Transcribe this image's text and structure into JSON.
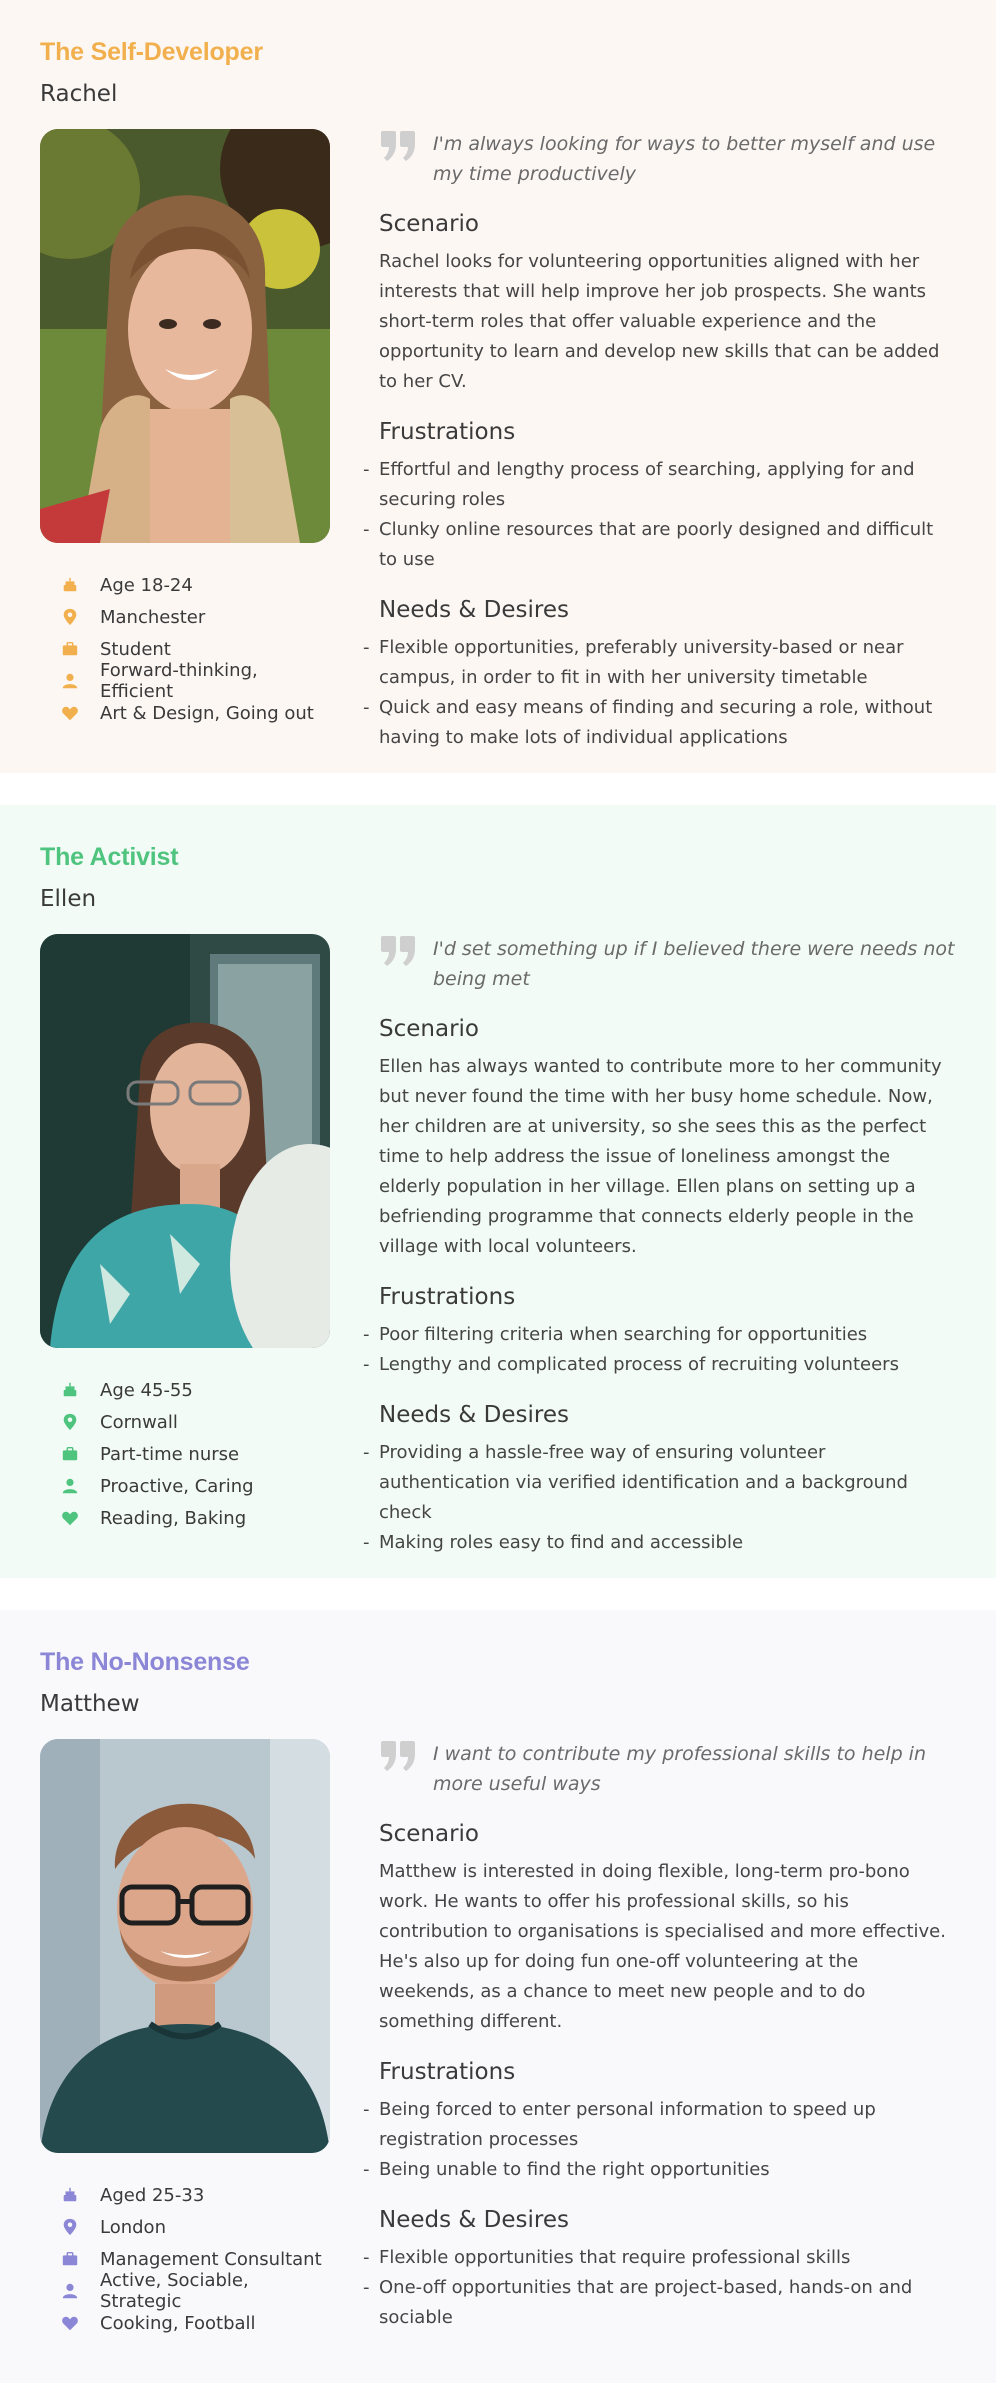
{
  "personas": [
    {
      "type": "The Self-Developer",
      "name": "Rachel",
      "accent": "#f1b04d",
      "quote": "I'm always looking for ways to better myself and use my time productively",
      "scenario_heading": "Scenario",
      "scenario": "Rachel looks for volunteering opportunities aligned with her interests that will help improve her job prospects. She wants short-term roles that offer valuable experience and the opportunity to learn and develop new skills that can be added to her CV.",
      "frustrations_heading": "Frustrations",
      "frustrations": [
        "Effortful and lengthy process of searching, applying for and securing roles",
        "Clunky online resources that are poorly designed and difficult to use"
      ],
      "needs_heading": "Needs & Desires",
      "needs": [
        "Flexible opportunities, preferably university-based or near campus, in order to fit in with her university timetable",
        "Quick and easy means of finding and securing a role, without having to make lots of individual applications"
      ],
      "facts": [
        {
          "icon": "cake-icon",
          "text": "Age 18-24"
        },
        {
          "icon": "location-pin-icon",
          "text": "Manchester"
        },
        {
          "icon": "briefcase-icon",
          "text": "Student"
        },
        {
          "icon": "person-icon",
          "text": "Forward-thinking, Efficient"
        },
        {
          "icon": "heart-icon",
          "text": "Art & Design, Going out"
        }
      ]
    },
    {
      "type": "The Activist",
      "name": "Ellen",
      "accent": "#4fc47e",
      "quote": "I'd set something up if I believed there were needs not being met",
      "scenario_heading": "Scenario",
      "scenario": "Ellen has always wanted to contribute more to her community but never found the time with her busy home schedule. Now, her children are at university, so she sees this as the perfect time to help address the issue of loneliness amongst the elderly population in her village. Ellen plans on setting up a befriending programme that connects elderly people in the village with local volunteers.",
      "frustrations_heading": "Frustrations",
      "frustrations": [
        "Poor filtering criteria when searching for opportunities",
        "Lengthy and complicated process of recruiting volunteers"
      ],
      "needs_heading": "Needs & Desires",
      "needs": [
        "Providing a hassle-free way of ensuring volunteer authentication via verified identification and a background check",
        "Making roles easy to find and accessible"
      ],
      "facts": [
        {
          "icon": "cake-icon",
          "text": "Age 45-55"
        },
        {
          "icon": "location-pin-icon",
          "text": "Cornwall"
        },
        {
          "icon": "briefcase-icon",
          "text": "Part-time nurse"
        },
        {
          "icon": "person-icon",
          "text": "Proactive, Caring"
        },
        {
          "icon": "heart-icon",
          "text": "Reading, Baking"
        }
      ]
    },
    {
      "type": "The No-Nonsense",
      "name": "Matthew",
      "accent": "#8b86d6",
      "quote": "I want to contribute my professional skills to help in more useful ways",
      "scenario_heading": "Scenario",
      "scenario": "Matthew is interested in doing flexible, long-term pro-bono work. He wants to offer his professional skills, so his contribution to organisations is specialised and more effective. He's also up for doing fun one-off volunteering at the weekends, as a chance to meet new people and to do something different.",
      "frustrations_heading": "Frustrations",
      "frustrations": [
        "Being forced to enter personal information to speed up registration processes",
        "Being unable to find the right opportunities"
      ],
      "needs_heading": "Needs & Desires",
      "needs": [
        "Flexible opportunities that require professional skills",
        "One-off opportunities that are project-based, hands-on and sociable"
      ],
      "facts": [
        {
          "icon": "cake-icon",
          "text": "Aged 25-33"
        },
        {
          "icon": "location-pin-icon",
          "text": "London"
        },
        {
          "icon": "briefcase-icon",
          "text": "Management Consultant"
        },
        {
          "icon": "person-icon",
          "text": "Active, Sociable, Strategic"
        },
        {
          "icon": "heart-icon",
          "text": "Cooking, Football"
        }
      ]
    }
  ]
}
